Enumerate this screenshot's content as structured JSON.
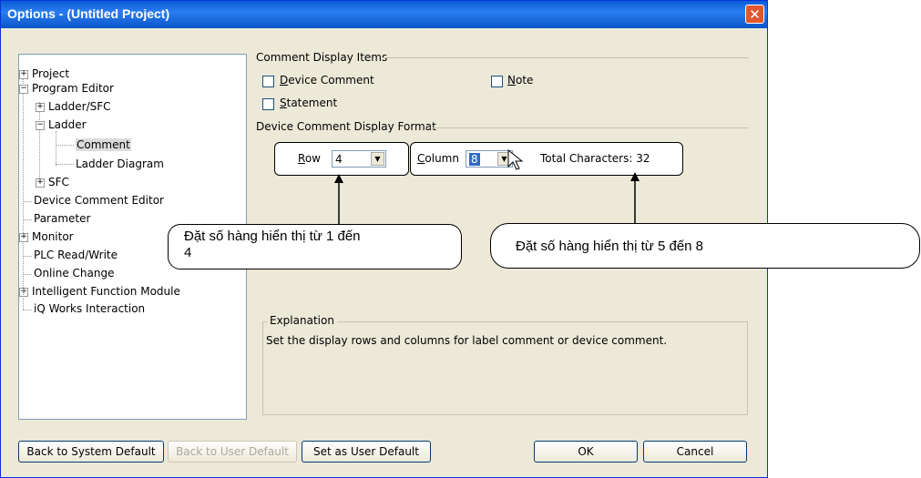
{
  "window": {
    "title": "Options - (Untitled Project)",
    "close_symbol": "✕"
  },
  "tree": {
    "items": [
      {
        "label": "Project",
        "expander": "+"
      },
      {
        "label": "Program Editor",
        "expander": "−"
      },
      {
        "label": "Ladder/SFC",
        "expander": "+"
      },
      {
        "label": "Ladder",
        "expander": "−"
      },
      {
        "label": "Comment",
        "selected": true
      },
      {
        "label": "Ladder Diagram"
      },
      {
        "label": "SFC",
        "expander": "+"
      },
      {
        "label": "Device Comment Editor"
      },
      {
        "label": "Parameter"
      },
      {
        "label": "Monitor",
        "expander": "+"
      },
      {
        "label": "PLC Read/Write"
      },
      {
        "label": "Online Change"
      },
      {
        "label": "Intelligent Function Module",
        "expander": "+"
      },
      {
        "label": "iQ Works Interaction"
      }
    ]
  },
  "comment_display_items": {
    "heading": "Comment Display Items",
    "device_comment": {
      "label_u": "D",
      "label_rest": "evice Comment",
      "checked": false
    },
    "note": {
      "label_u": "N",
      "label_rest": "ote",
      "checked": false
    },
    "statement": {
      "label_u": "S",
      "label_rest": "tatement",
      "checked": false
    }
  },
  "format": {
    "heading": "Device Comment Display Format",
    "row": {
      "label_u": "R",
      "label_rest": "ow",
      "value": "4"
    },
    "column": {
      "label_u": "C",
      "label_rest": "olumn",
      "value": "8"
    },
    "total_label": "Total Characters:",
    "total_value": "32"
  },
  "annotations": {
    "left": "Đặt số hàng hiển thị từ 1 đến 4",
    "right": "Đặt số hàng hiển thị từ 5 đến 8"
  },
  "explanation": {
    "heading": "Explanation",
    "text": "Set the display rows and columns for label comment or device comment."
  },
  "buttons": {
    "back_system": "Back to System Default",
    "back_user": "Back to User Default",
    "set_user": "Set as User Default",
    "ok": "OK",
    "cancel": "Cancel"
  },
  "colors": {
    "title_bar": "#0a5bd6",
    "dialog_bg": "#ece9d8",
    "close_red": "#e0562f"
  }
}
